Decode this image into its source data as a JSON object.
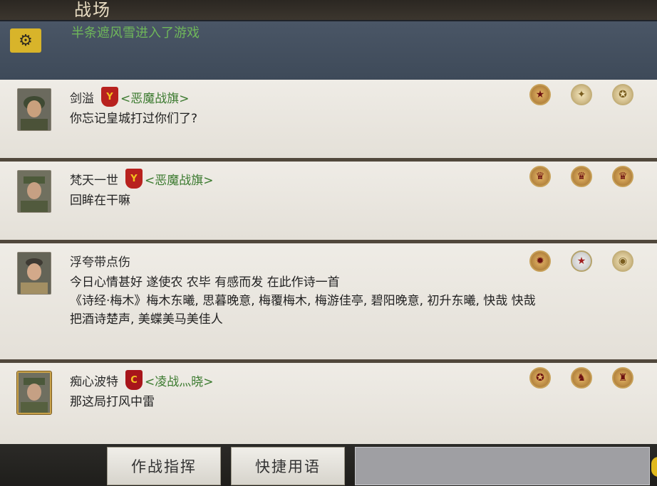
{
  "header": {
    "title": "战场"
  },
  "system_notice": {
    "text": "半条遮风雪进入了游戏",
    "icon": "gear-icon"
  },
  "messages": [
    {
      "name": "剑溢",
      "guild": "<恶魔战旗>",
      "guild_badge": "Y",
      "lines": [
        "你忘记皇城打过你们了?"
      ],
      "medals": [
        "star-medal",
        "wings-medal",
        "eagle-medal"
      ]
    },
    {
      "name": "梵天一世",
      "guild": "<恶魔战旗>",
      "guild_badge": "Y",
      "lines": [
        "回眸在干嘛"
      ],
      "medals": [
        "crown-medal",
        "crown-medal",
        "crown-medal"
      ]
    },
    {
      "name": "浮夸带点伤",
      "guild": "",
      "guild_badge": "",
      "lines": [
        "今日心情甚好 遂使农 农毕 有感而发 在此作诗一首",
        "《诗经·梅木》梅木东曦, 思暮晚意, 梅覆梅木, 梅游佳亭, 碧阳晚意, 初升东曦, 快哉 快哉",
        "把酒诗楚声, 美蝶美马美佳人"
      ],
      "medals": [
        "ribbon-medal",
        "ribbon-star-medal",
        "round-medal"
      ]
    },
    {
      "name": "痴心波特",
      "guild": "<凌战灬晓>",
      "guild_badge": "C",
      "lines": [
        "那这局打风中雷"
      ],
      "medals": [
        "eagle-gold-medal",
        "tiger-medal",
        "shield-medal"
      ]
    }
  ],
  "footer": {
    "command_button": "作战指挥",
    "quick_phrases_button": "快捷用语"
  }
}
